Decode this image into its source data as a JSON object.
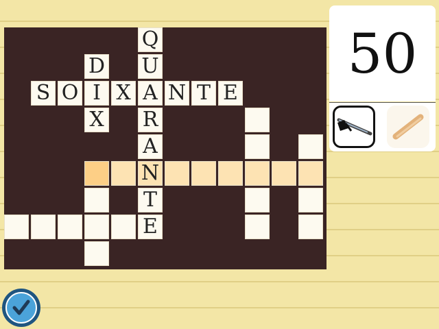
{
  "score": "50",
  "tools": [
    {
      "name": "pen",
      "selected": true
    },
    {
      "name": "pencil",
      "selected": false
    }
  ],
  "colors": {
    "board": "#3a2424",
    "cell": "#fdfaf0",
    "highlight_row": "#fde3b3",
    "current_cell": "#fdcf86",
    "paper": "#f3e6a6",
    "check_button": "#4ba3d9"
  },
  "grid": {
    "cols": 12,
    "rows": 9,
    "cells": [
      {
        "r": 0,
        "c": 5,
        "letter": "Q"
      },
      {
        "r": 1,
        "c": 3,
        "letter": "D"
      },
      {
        "r": 1,
        "c": 5,
        "letter": "U"
      },
      {
        "r": 2,
        "c": 1,
        "letter": "S"
      },
      {
        "r": 2,
        "c": 2,
        "letter": "O"
      },
      {
        "r": 2,
        "c": 3,
        "letter": "I"
      },
      {
        "r": 2,
        "c": 4,
        "letter": "X"
      },
      {
        "r": 2,
        "c": 5,
        "letter": "A"
      },
      {
        "r": 2,
        "c": 6,
        "letter": "N"
      },
      {
        "r": 2,
        "c": 7,
        "letter": "T"
      },
      {
        "r": 2,
        "c": 8,
        "letter": "E"
      },
      {
        "r": 3,
        "c": 3,
        "letter": "X"
      },
      {
        "r": 3,
        "c": 5,
        "letter": "R"
      },
      {
        "r": 3,
        "c": 9,
        "letter": ""
      },
      {
        "r": 4,
        "c": 5,
        "letter": "A"
      },
      {
        "r": 4,
        "c": 9,
        "letter": ""
      },
      {
        "r": 4,
        "c": 11,
        "letter": ""
      },
      {
        "r": 5,
        "c": 3,
        "letter": "",
        "state": "current"
      },
      {
        "r": 5,
        "c": 4,
        "letter": "",
        "state": "highlight"
      },
      {
        "r": 5,
        "c": 5,
        "letter": "N",
        "state": "highlight"
      },
      {
        "r": 5,
        "c": 6,
        "letter": "",
        "state": "highlight"
      },
      {
        "r": 5,
        "c": 7,
        "letter": "",
        "state": "highlight"
      },
      {
        "r": 5,
        "c": 8,
        "letter": "",
        "state": "highlight"
      },
      {
        "r": 5,
        "c": 9,
        "letter": "",
        "state": "highlight"
      },
      {
        "r": 5,
        "c": 10,
        "letter": "",
        "state": "highlight"
      },
      {
        "r": 5,
        "c": 11,
        "letter": "",
        "state": "highlight"
      },
      {
        "r": 6,
        "c": 3,
        "letter": ""
      },
      {
        "r": 6,
        "c": 5,
        "letter": "T"
      },
      {
        "r": 6,
        "c": 9,
        "letter": ""
      },
      {
        "r": 6,
        "c": 11,
        "letter": ""
      },
      {
        "r": 7,
        "c": 0,
        "letter": ""
      },
      {
        "r": 7,
        "c": 1,
        "letter": ""
      },
      {
        "r": 7,
        "c": 2,
        "letter": ""
      },
      {
        "r": 7,
        "c": 3,
        "letter": ""
      },
      {
        "r": 7,
        "c": 4,
        "letter": ""
      },
      {
        "r": 7,
        "c": 5,
        "letter": "E"
      },
      {
        "r": 7,
        "c": 9,
        "letter": ""
      },
      {
        "r": 7,
        "c": 11,
        "letter": ""
      },
      {
        "r": 8,
        "c": 3,
        "letter": ""
      }
    ]
  }
}
